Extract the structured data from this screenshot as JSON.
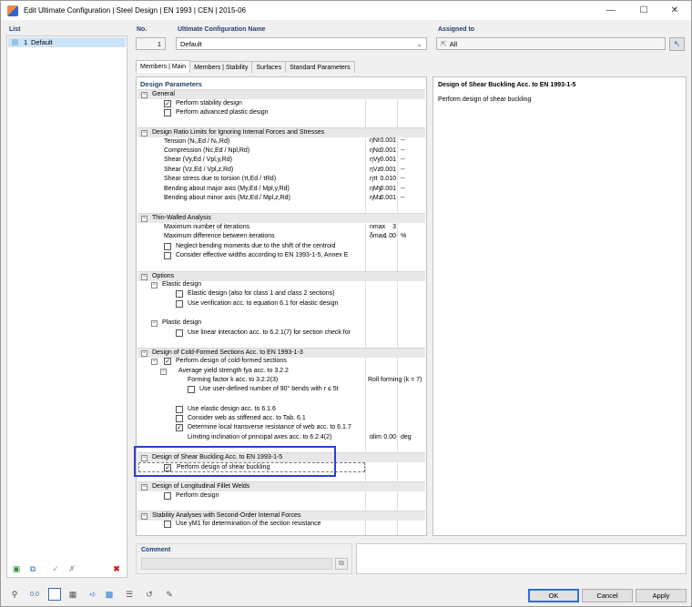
{
  "title": "Edit Ultimate Configuration | Steel Design | EN 1993 | CEN | 2015-06",
  "list": {
    "label": "List",
    "items": [
      {
        "no": "1",
        "name": "Default"
      }
    ]
  },
  "no": {
    "label": "No.",
    "value": "1"
  },
  "config_name": {
    "label": "Ultimate Configuration Name",
    "value": "Default"
  },
  "assigned": {
    "label": "Assigned to",
    "value": "All"
  },
  "tabs": [
    "Members | Main",
    "Members | Stability",
    "Surfaces",
    "Standard Parameters"
  ],
  "design_params_label": "Design Parameters",
  "groups": {
    "general": {
      "title": "General",
      "items": [
        "Perform stability design",
        "Perform advanced plastic design"
      ]
    },
    "ratio": {
      "title": "Design Ratio Limits for Ignoring Internal Forces and Stresses",
      "rows": [
        {
          "label": "Tension (Nₜ,Ed / Nₜ,Rd)",
          "sym": "ηNt",
          "val": "0.001",
          "unit": "--"
        },
        {
          "label": "Compression (Nc,Ed / Npl,Rd)",
          "sym": "ηNc",
          "val": "0.001",
          "unit": "--"
        },
        {
          "label": "Shear (Vy,Ed / Vpl,y,Rd)",
          "sym": "ηVy",
          "val": "0.001",
          "unit": "--"
        },
        {
          "label": "Shear (Vz,Ed / Vpl,z,Rd)",
          "sym": "ηVz",
          "val": "0.001",
          "unit": "--"
        },
        {
          "label": "Shear stress due to torsion (τt,Ed / τRd)",
          "sym": "ητt",
          "val": "0.010",
          "unit": "--"
        },
        {
          "label": "Bending about major axis (My,Ed / Mpl,y,Rd)",
          "sym": "ηMy",
          "val": "0.001",
          "unit": "--"
        },
        {
          "label": "Bending about minor axis (Mz,Ed / Mpl,z,Rd)",
          "sym": "ηMz",
          "val": "0.001",
          "unit": "--"
        }
      ]
    },
    "thin": {
      "title": "Thin-Walled Analysis",
      "rows": [
        {
          "label": "Maximum number of iterations",
          "sym": "nmax",
          "val": "3",
          "unit": ""
        },
        {
          "label": "Maximum difference between iterations",
          "sym": "δmax",
          "val": "1.00",
          "unit": "%"
        }
      ],
      "items": [
        "Neglect bending moments due to the shift of the centroid",
        "Consider effective widths according to EN 1993-1-5, Annex E"
      ]
    },
    "options": {
      "title": "Options",
      "elastic": "Elastic design",
      "elastic_items": [
        "Elastic design (also for class 1 and class 2 sections)",
        "Use verification acc. to equation 6.1 for elastic design"
      ],
      "plastic": "Plastic design",
      "plastic_items": [
        "Use linear interaction acc. to 6.2.1(7) for section check for"
      ]
    },
    "cold": {
      "title": "Design of Cold-Formed Sections Acc. to EN 1993-1-3",
      "perform": "Perform design of cold-formed sections",
      "avg": "Average yield strength fya acc. to 3.2.2",
      "forming": "Forming factor k acc. to 3.2.2(3)",
      "forming_val": "Roll forming (k = 7)",
      "userdef": "Use user-defined number of 90° bends with r ≤ 5t",
      "items": [
        "Use elastic design acc. to 6.1.6",
        "Consider web as stiffened acc. to Tab. 6.1",
        "Determine local transverse resistance of web acc. to 6.1.7"
      ],
      "limiting": "Limiting inclination of principal axes acc. to 6.2.4(2)",
      "lim_sym": "αlim",
      "lim_val": "0.00",
      "lim_unit": "deg"
    },
    "shear": {
      "title": "Design of Shear Buckling Acc. to EN 1993-1-5",
      "item": "Perform design of shear buckling"
    },
    "welds": {
      "title": "Design of Longitudinal Fillet Welds",
      "item": "Perform design"
    },
    "stab": {
      "title": "Stability Analyses with Second-Order Internal Forces",
      "item": "Use γM1 for determination of the section resistance"
    }
  },
  "right": {
    "title": "Design of Shear Buckling Acc. to EN 1993-1-5",
    "text": "Perform design of shear buckling"
  },
  "comment_label": "Comment",
  "buttons": {
    "ok": "OK",
    "cancel": "Cancel",
    "apply": "Apply"
  }
}
